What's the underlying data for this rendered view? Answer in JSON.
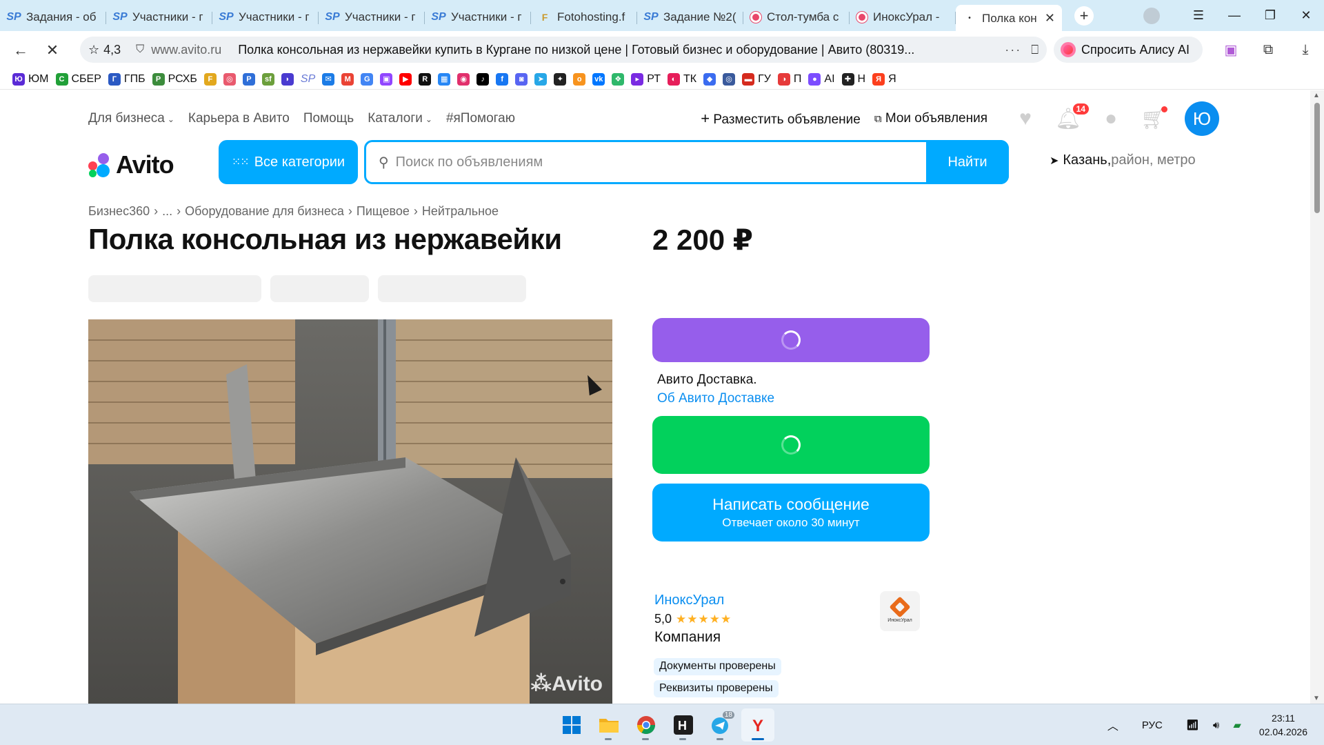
{
  "tabs": [
    {
      "icon": "SP",
      "title": "Задания - об"
    },
    {
      "icon": "SP",
      "title": "Участники - г"
    },
    {
      "icon": "SP",
      "title": "Участники - г"
    },
    {
      "icon": "SP",
      "title": "Участники - г"
    },
    {
      "icon": "SP",
      "title": "Участники - г"
    },
    {
      "icon": "F",
      "title": "Fotohosting.f"
    },
    {
      "icon": "SP",
      "title": "Задание №2("
    },
    {
      "icon": "dot",
      "title": "Стол-тумба с"
    },
    {
      "icon": "dot",
      "title": "ИноксУрал -"
    }
  ],
  "active_tab": {
    "title": "Полка кон",
    "close": "✕"
  },
  "new_tab": "+",
  "address": {
    "rating": "4,3",
    "host": "www.avito.ru",
    "page_title": "Полка консольная из нержавейки купить в Кургане по низкой цене | Готовый бизнес и оборудование | Авито (80319...",
    "more": "···",
    "alice": "Спросить Алису AI"
  },
  "bookmarks": [
    {
      "label": "ЮМ",
      "color": "#5a2bd6",
      "glyph": "Ю"
    },
    {
      "label": "СБЕР",
      "color": "#21a038",
      "glyph": "С"
    },
    {
      "label": "ГПБ",
      "color": "#2b59c3",
      "glyph": "Г"
    },
    {
      "label": "РСХБ",
      "color": "#3c8c3c",
      "glyph": "Р"
    },
    {
      "label": "",
      "color": "#e2a81e",
      "glyph": "F"
    },
    {
      "label": "",
      "color": "#e95a6e",
      "glyph": "◎"
    },
    {
      "label": "",
      "color": "#2f6fd8",
      "glyph": "P"
    },
    {
      "label": "",
      "color": "#6c9f3c",
      "glyph": "sf"
    },
    {
      "label": "",
      "color": "#4a3bd0",
      "glyph": "◗"
    },
    {
      "label": "SP",
      "color": "#ffffff",
      "glyph": ""
    },
    {
      "label": "",
      "color": "#1c7ce6",
      "glyph": "✉"
    },
    {
      "label": "",
      "color": "#ea4335",
      "glyph": "M"
    },
    {
      "label": "",
      "color": "#4285f4",
      "glyph": "G"
    },
    {
      "label": "",
      "color": "#9146ff",
      "glyph": "▣"
    },
    {
      "label": "",
      "color": "#ff0000",
      "glyph": "▶"
    },
    {
      "label": "",
      "color": "#111111",
      "glyph": "R"
    },
    {
      "label": "",
      "color": "#2787f5",
      "glyph": "▦"
    },
    {
      "label": "",
      "color": "#e1306c",
      "glyph": "◉"
    },
    {
      "label": "",
      "color": "#000000",
      "glyph": "♪"
    },
    {
      "label": "",
      "color": "#1877f2",
      "glyph": "f"
    },
    {
      "label": "",
      "color": "#5865f2",
      "glyph": "◙"
    },
    {
      "label": "",
      "color": "#27a7e7",
      "glyph": "➤"
    },
    {
      "label": "",
      "color": "#222222",
      "glyph": "✦"
    },
    {
      "label": "",
      "color": "#f7931e",
      "glyph": "о"
    },
    {
      "label": "",
      "color": "#0077ff",
      "glyph": "vk"
    },
    {
      "label": "",
      "color": "#2fb86b",
      "glyph": "❖"
    },
    {
      "label": "РТ",
      "color": "#7a2be2",
      "glyph": "▸"
    },
    {
      "label": "ТК",
      "color": "#e61e5a",
      "glyph": "◐"
    },
    {
      "label": "",
      "color": "#3b6cf0",
      "glyph": "◆"
    },
    {
      "label": "",
      "color": "#3a5a9c",
      "glyph": "◎"
    },
    {
      "label": "ГУ",
      "color": "#d52b1e",
      "glyph": "▬"
    },
    {
      "label": "П",
      "color": "#e63a3a",
      "glyph": "◑"
    },
    {
      "label": "AI",
      "color": "#7c4dff",
      "glyph": "●"
    },
    {
      "label": "Н",
      "color": "#222222",
      "glyph": "✚"
    },
    {
      "label": "Я",
      "color": "#fc3f1d",
      "glyph": "Я"
    }
  ],
  "site": {
    "nav": {
      "business": "Для бизнеса",
      "career": "Карьера в Авито",
      "help": "Помощь",
      "catalogs": "Каталоги",
      "ihelp": "#яПомогаю"
    },
    "post_ad": "Разместить объявление",
    "my_ads": "Мои объявления",
    "notifications_count": "14",
    "avatar_letter": "Ю",
    "logo_text": "Avito",
    "all_categories": "Все категории",
    "search_placeholder": "Поиск по объявлениям",
    "search_button": "Найти",
    "location_city": "Казань,",
    "location_rest": " район, метро"
  },
  "breadcrumbs": [
    "Бизнес360",
    "...",
    "Оборудование для бизнеса",
    "Пищевое",
    "Нейтральное"
  ],
  "listing": {
    "title": "Полка консольная из нержавейки",
    "price": "2 200 ₽",
    "watermark": "Avito",
    "delivery_title": "Авито Доставка.",
    "delivery_link": "Об Авито Доставке",
    "message_button": "Написать сообщение",
    "message_sub": "Отвечает около 30 минут"
  },
  "seller": {
    "name": "ИноксУрал",
    "rating": "5,0",
    "stars": "★★★★★",
    "type": "Компания",
    "logo_text": "ИноксУрал",
    "tags": [
      "Документы проверены",
      "Реквизиты проверены"
    ]
  },
  "taskbar": {
    "telegram_badge": "18",
    "lang": "РУС",
    "time": "23:11",
    "date": "02.04.2026"
  },
  "colors": {
    "avito_blue": "#00aaff",
    "delivery_purple": "#965eeb",
    "call_green": "#02d15c",
    "link_blue": "#0a8ef0"
  }
}
